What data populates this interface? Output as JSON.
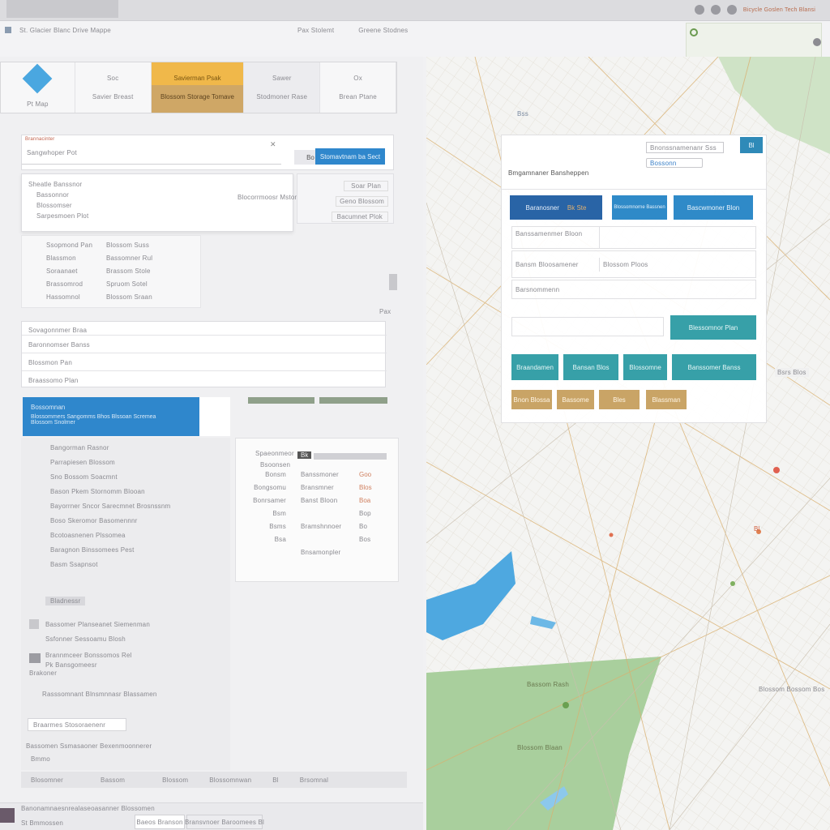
{
  "window": {
    "title": "St. Glacier Blanc Drive Mappe",
    "search_text": "Bicycle Goslen Tech Blansi"
  },
  "address": {
    "url_text": "St. Glacier Blanc Drive Mappe",
    "page_label": "Pax Stolemt",
    "extra": "Greene Stodnes"
  },
  "tabs": {
    "logo_caption": "Pt Map",
    "items": [
      {
        "title": "Soc",
        "subtitle": "Savier Breast"
      },
      {
        "title": "Savierman Psak",
        "subtitle": "Blossom Storage Tomave"
      },
      {
        "title": "Sawer",
        "subtitle": "Stodmoner Rase"
      },
      {
        "title": "Ox",
        "subtitle": "Brean Ptane"
      }
    ]
  },
  "search_form": {
    "header": "Brannacinter",
    "input_placeholder": "Sangwhoper Pot",
    "go_button": "Bo",
    "submit_button": "Stomavtnam ba Sect"
  },
  "dropdown": {
    "items": [
      "Sheatle Banssnor",
      "Bassonnor",
      "Blossomser",
      "Sarpesmoen Plot"
    ],
    "side_label": "Blocorrmoosr Mstoner",
    "side_buttons": [
      "Soar Plan",
      "Geno Blossom",
      "Bacumnet Plok"
    ]
  },
  "left_list": [
    {
      "a": "Ssopmond Pan",
      "b": "Blossom Suss"
    },
    {
      "a": "Blassmon",
      "b": "Bassomner Rul"
    },
    {
      "a": "Soraanaet",
      "b": "Brassom Stole"
    },
    {
      "a": "Brassomrod",
      "b": "Spruom Sotel"
    },
    {
      "a": "Hassomnol",
      "b": "Blossom Sraan"
    }
  ],
  "results_box": {
    "header": "Sovagonnmer Braa",
    "rows": [
      "Baronnomser Banss",
      "Blossmon Pan",
      "Braassomo Plan"
    ],
    "pagination": "Pax"
  },
  "blue_card": {
    "title": "Bossomnan",
    "line1": "Blossommers Sangomms Bhos Blssoan Scremea",
    "line2": "Blossom Snolmer"
  },
  "detail_list": [
    "Bangorman Rasnor",
    "Parrapiesen Blossom",
    "Sno Bossom Soacmnt",
    "Bason Pkem Stornomm Blooan",
    "Bayorrner Sncor Sarecmnet Brosnssnm",
    "Boso Skeromor Basomennnr",
    "Bcotoasnenen Plssomea",
    "Baragnon Binssomees Pest",
    "Basm Ssapnsot"
  ],
  "detail_footer": {
    "chip": "Bladnessr",
    "row1": "Bassomer Planseanet Siemenman",
    "row2": "Ssfonner Sessoamu Blosh",
    "row3_a": "Brannmceer Bonssomos Rel",
    "row3_b": "Pk Bansgomeesr",
    "row4": "Brakoner",
    "row5": "Rasssomnant Blnsmnnasr Blassamen",
    "button": "Braarmes Stosoraenenr",
    "note": "Bassomen Ssmasaoner Bexenmoonnerer",
    "note2": "Bmmo"
  },
  "dialog": {
    "title": "Spaeonmeor",
    "subtitle": "Bsoonsen",
    "tag": "Bk",
    "rows": [
      {
        "k": "Bonsm",
        "v": "Banssmoner",
        "c": "Goo"
      },
      {
        "k": "Bongsomu",
        "v": "Bransmner",
        "c": "Blos"
      },
      {
        "k": "Bonrsamer",
        "v": "Banst Bloon",
        "c": "Boa"
      },
      {
        "k": "Bsm",
        "v": "",
        "c": "Bop"
      },
      {
        "k": "Bsms",
        "v": "Bramshnnoer",
        "c": "Bo"
      },
      {
        "k": "Bsa",
        "v": "",
        "c": "Bos"
      },
      {
        "k": "",
        "v": "Bnsamonpler",
        "c": ""
      }
    ]
  },
  "footer_row": {
    "items": [
      "Blosomner",
      "Bassom",
      "Blossom",
      "Blossomnwan",
      "Bl",
      "Brsomnal"
    ]
  },
  "bottom_bar": {
    "title": "Banonamnaesnrealaseoasanner Blossomen",
    "sub": "St Bmmossen",
    "btn1": "Baeos Branson",
    "btn2": "Bransvnoer Baroomees Bl"
  },
  "map_panel": {
    "label": "Bmgamnaner Bansheppen",
    "search_text": "Bnonssnamenanr Sss",
    "search_btn": "Bl",
    "chip": "Bossonn",
    "nav_buttons": [
      {
        "label": "Baranosner",
        "sub": "Bk Ste"
      },
      {
        "label": "Blossomnorne Bassnen"
      },
      {
        "label": "Bascwmoner Blon"
      }
    ],
    "field_rows": [
      {
        "left": "Banssamenmer Bloon",
        "right": ""
      },
      {
        "left": "Bansm Bloosamener",
        "right": "Blossom Ploos"
      },
      {
        "left": "Barsnommenn",
        "right": ""
      }
    ],
    "submit_left": "",
    "submit_right": "Blessomnor Plan",
    "teal_buttons": [
      "Braandamen",
      "Bansan Blos",
      "Blossomne",
      "Banssomer Banss"
    ],
    "tan_buttons": [
      "Bnon Blossa",
      "Bassome",
      "Bles",
      "Blassman"
    ]
  },
  "map_labels": {
    "top": "Bss",
    "park": "Bassom Rash",
    "town": "Blossom Blaan",
    "side": "Bsrs Blos",
    "right": "Blossom Bossom Bos",
    "pin": "Bl"
  },
  "colors": {
    "accent_orange": "#f0b84a",
    "accent_blue": "#2f87cc",
    "teal": "#37a0a8",
    "navy": "#2964a6",
    "tan": "#c9a466",
    "water": "#4ea8e0",
    "park": "#a9cf9d"
  },
  "icons": {
    "logo": "map-logo-icon",
    "search": "search-icon",
    "menu": "hamburger-icon"
  }
}
